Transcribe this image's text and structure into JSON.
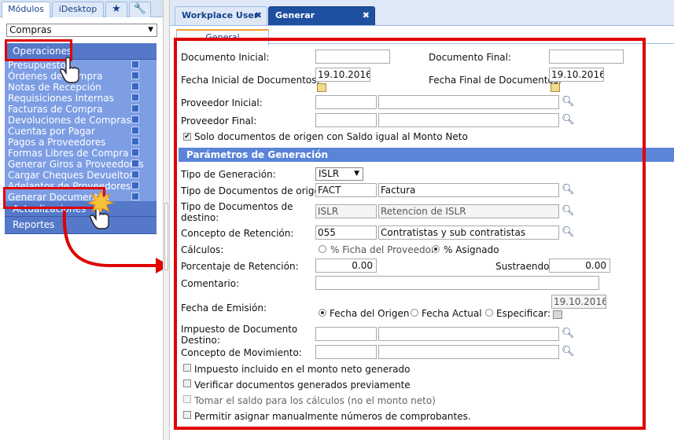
{
  "left_panel": {
    "tabs": [
      "Módulos",
      "iDesktop"
    ],
    "module_select": "Compras",
    "sections": {
      "operaciones": "Operaciones",
      "actualizaciones": "Actualizaciones",
      "reportes": "Reportes"
    },
    "menu_items": [
      "Presupuestos",
      "Órdenes de Compra",
      "Notas de Recepción",
      "Requisiciones Internas",
      "Facturas de Compra",
      "Devoluciones de Compras",
      "Cuentas por Pagar",
      "Pagos a Proveedores",
      "Formas Libres de Compra",
      "Generar Giros a Proveedores",
      "Cargar Cheques Devueltos",
      "Adelantos de Proveedores",
      "Generar Documentos"
    ]
  },
  "window_tabs": [
    "Workplace User",
    "Generar Documentos"
  ],
  "subtab": "General",
  "form": {
    "doc_inicial": {
      "label": "Documento Inicial:",
      "value": ""
    },
    "doc_final": {
      "label": "Documento Final:",
      "value": ""
    },
    "fecha_inicial": {
      "label": "Fecha Inicial de Documentos:",
      "value": "19.10.2016"
    },
    "fecha_final": {
      "label": "Fecha Final de Documentos:",
      "value": "19.10.2016"
    },
    "proveedor_inicial": {
      "label": "Proveedor Inicial:",
      "code": "",
      "name": ""
    },
    "proveedor_final": {
      "label": "Proveedor Final:",
      "code": "",
      "name": ""
    },
    "solo_docs": {
      "label": "Solo documentos de origen con Saldo igual al Monto Neto",
      "checked": true
    }
  },
  "params": {
    "section_title": "Parámetros de Generación",
    "tipo_generacion": {
      "label": "Tipo de Generación:",
      "value": "ISLR"
    },
    "tipo_doc_origen": {
      "label": "Tipo de Documentos de origen:",
      "code": "FACT",
      "name": "Factura"
    },
    "tipo_doc_destino": {
      "label_1": "Tipo de Documentos de",
      "label_2": "destino:",
      "code": "ISLR",
      "name": "Retencion de ISLR"
    },
    "concepto_retencion": {
      "label": "Concepto de Retención:",
      "code": "055",
      "name": "Contratistas y sub contratistas"
    },
    "calculos": {
      "label": "Cálculos:",
      "opt1": "% Ficha del Proveedor",
      "opt2": "% Asignado",
      "selected": "% Asignado"
    },
    "porcentaje": {
      "label": "Porcentaje de Retención:",
      "value": "0.00"
    },
    "sustraendo": {
      "label": "Sustraendo:",
      "value": "0.00"
    },
    "comentario": {
      "label": "Comentario:",
      "value": ""
    },
    "fecha_emision": {
      "label": "Fecha de Emisión:",
      "opt1": "Fecha del Origen",
      "opt2": "Fecha Actual",
      "opt3": "Especificar:",
      "selected": "Fecha del Origen",
      "date": "19.10.2016"
    },
    "impuesto_doc": {
      "label_1": "Impuesto de Documento",
      "label_2": "Destino:",
      "code": "",
      "name": ""
    },
    "concepto_mov": {
      "label": "Concepto de Movimiento:",
      "code": "",
      "name": ""
    },
    "checks": [
      "Impuesto incluido en el monto neto generado",
      "Verificar documentos generados previamente",
      "Tomar el saldo para los cálculos (no el monto neto)",
      "Permitir asignar manualmente números de comprobantes."
    ]
  },
  "colors": {
    "accent_red": "#e00000",
    "menu_blue": "#7e9ee4",
    "header_blue": "#5578c9"
  },
  "icons": [
    "star-icon",
    "wrench-icon",
    "close-icon",
    "search-icon",
    "calendar-icon",
    "hand-pointer-icon"
  ]
}
